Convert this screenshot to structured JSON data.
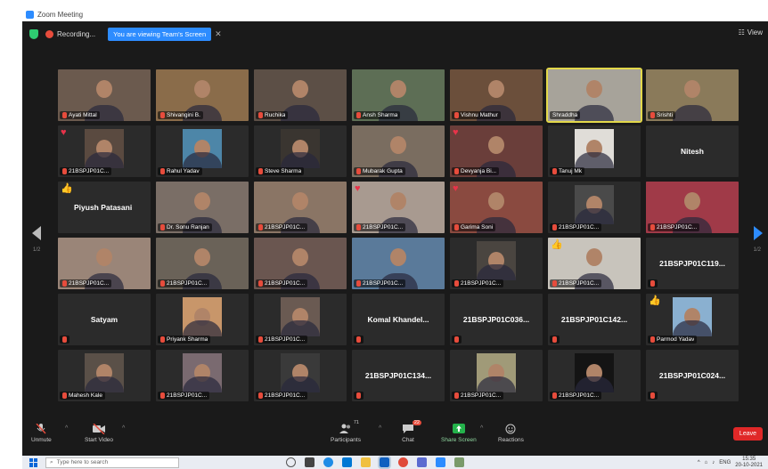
{
  "window": {
    "title": "Zoom Meeting"
  },
  "topbar": {
    "recording_label": "Recording...",
    "share_label": "You are viewing Team's Screen",
    "view_label": "View"
  },
  "participants": [
    {
      "name": "Ayati Mittal",
      "muted": true,
      "video": true,
      "color": "#6b5a4e"
    },
    {
      "name": "Shivangini B.",
      "muted": true,
      "video": true,
      "color": "#8a6c4a"
    },
    {
      "name": "Ruchika",
      "muted": true,
      "video": true,
      "color": "#5c4f46"
    },
    {
      "name": "Ansh Sharma",
      "muted": true,
      "video": true,
      "color": "#5d6e55"
    },
    {
      "name": "Vishnu Mathur",
      "muted": true,
      "video": true,
      "color": "#6b4f3b"
    },
    {
      "name": "Shraddha",
      "muted": false,
      "video": true,
      "color": "#a7a39a",
      "active": true
    },
    {
      "name": "Srishti",
      "muted": true,
      "video": true,
      "color": "#8a7a5a"
    },
    {
      "name": "21BSPJP01C...",
      "muted": true,
      "video": true,
      "color": "#5a4a40",
      "reaction": "heart",
      "small": true
    },
    {
      "name": "Rahul Yadav",
      "muted": true,
      "video": true,
      "color": "#4d86a8",
      "small": true
    },
    {
      "name": "Steve Sharma",
      "muted": true,
      "video": true,
      "color": "#3a3530",
      "small": true
    },
    {
      "name": "Mubarak Gupta",
      "muted": true,
      "video": true,
      "color": "#7a6d60"
    },
    {
      "name": "Devyanja Bi...",
      "muted": true,
      "video": true,
      "color": "#6a3e3a",
      "reaction": "heart"
    },
    {
      "name": "Tanuj Mk",
      "muted": true,
      "video": true,
      "color": "#e0ddd8",
      "small": true
    },
    {
      "name": "Nitesh",
      "muted": false,
      "video": false
    },
    {
      "name": "Piyush Patasani",
      "muted": false,
      "video": false,
      "reaction": "thumb",
      "left": true
    },
    {
      "name": "Dr. Sonu Ranjan",
      "muted": true,
      "video": true,
      "color": "#7a6e66"
    },
    {
      "name": "21BSPJP01C...",
      "muted": true,
      "video": true,
      "color": "#8a7565"
    },
    {
      "name": "21BSPJP01C...",
      "muted": true,
      "video": true,
      "color": "#a89a90",
      "reaction": "heart"
    },
    {
      "name": "Garima Soni",
      "muted": true,
      "video": true,
      "color": "#8a4a40",
      "reaction": "heart"
    },
    {
      "name": "21BSPJP01C...",
      "muted": true,
      "video": true,
      "color": "#4a4a4a",
      "small": true
    },
    {
      "name": "21BSPJP01C...",
      "muted": true,
      "video": true,
      "color": "#a03a48"
    },
    {
      "name": "21BSPJP01C...",
      "muted": true,
      "video": true,
      "color": "#9a8578"
    },
    {
      "name": "21BSPJP01C...",
      "muted": true,
      "video": true,
      "color": "#6a6258"
    },
    {
      "name": "21BSPJP01C...",
      "muted": true,
      "video": true,
      "color": "#6a5650"
    },
    {
      "name": "21BSPJP01C...",
      "muted": true,
      "video": true,
      "color": "#5a7a9a"
    },
    {
      "name": "21BSPJP01C...",
      "muted": true,
      "video": true,
      "color": "#4a4540",
      "small": true
    },
    {
      "name": "21BSPJP01C...",
      "muted": true,
      "video": true,
      "color": "#c8c4bc",
      "reaction": "thumb"
    },
    {
      "name": "21BSPJP01C119...",
      "muted": true,
      "video": false
    },
    {
      "name": "Satyam",
      "muted": true,
      "video": false
    },
    {
      "name": "Priyank Sharma",
      "muted": true,
      "video": true,
      "color": "#c8966a",
      "small": true
    },
    {
      "name": "21BSPJP01C...",
      "muted": true,
      "video": true,
      "color": "#6a5a52",
      "small": true
    },
    {
      "name": "Komal Khandel...",
      "muted": true,
      "video": false
    },
    {
      "name": "21BSPJP01C036...",
      "muted": true,
      "video": false
    },
    {
      "name": "21BSPJP01C142...",
      "muted": true,
      "video": false
    },
    {
      "name": "Parmod Yadav",
      "muted": true,
      "video": true,
      "color": "#8ab0d0",
      "reaction": "thumb",
      "small": true
    },
    {
      "name": "Mahesh Kale",
      "muted": true,
      "video": true,
      "color": "#5a5048",
      "small": true
    },
    {
      "name": "21BSPJP01C...",
      "muted": true,
      "video": true,
      "color": "#7a6a70",
      "small": true
    },
    {
      "name": "21BSPJP01C...",
      "muted": true,
      "video": true,
      "color": "#3a3a3a",
      "small": true
    },
    {
      "name": "21BSPJP01C134...",
      "muted": true,
      "video": false
    },
    {
      "name": "21BSPJP01C...",
      "muted": true,
      "video": true,
      "color": "#a09a78",
      "small": true
    },
    {
      "name": "21BSPJP01C...",
      "muted": true,
      "video": true,
      "color": "#141414",
      "small": true
    },
    {
      "name": "21BSPJP01C024...",
      "muted": true,
      "video": false
    }
  ],
  "pager": {
    "left": "1/2",
    "right": "1/2"
  },
  "toolbar": {
    "unmute": "Unmute",
    "start_video": "Start Video",
    "participants": "Participants",
    "participants_count": "71",
    "chat": "Chat",
    "chat_badge": "22",
    "share_screen": "Share Screen",
    "reactions": "Reactions",
    "leave": "Leave"
  },
  "taskbar": {
    "search_placeholder": "Type here to search",
    "time": "15:35",
    "date": "20-10-2021",
    "lang": "ENG"
  },
  "colors": {
    "accent": "#2d8cff",
    "active_border": "#e3d84a",
    "leave": "#e02828"
  }
}
